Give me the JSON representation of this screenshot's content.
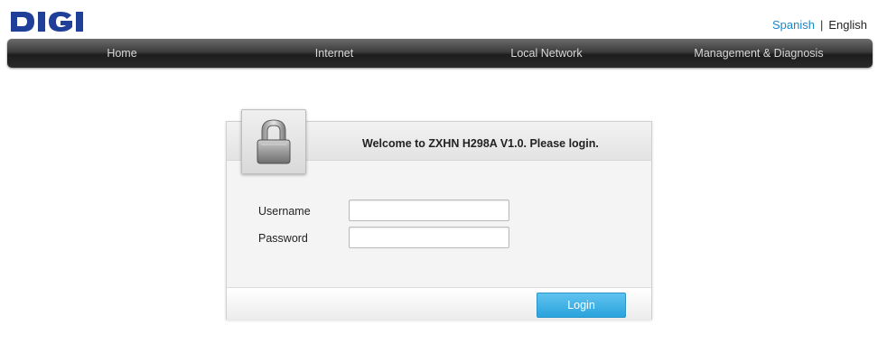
{
  "brand": {
    "logo_text": "DIGI",
    "logo_color": "#1f3f99"
  },
  "language": {
    "spanish": "Spanish",
    "separator": "|",
    "english": "English",
    "link_color": "#1a87c9"
  },
  "nav": {
    "items": [
      {
        "label": "Home"
      },
      {
        "label": "Internet"
      },
      {
        "label": "Local Network"
      },
      {
        "label": "Management & Diagnosis"
      }
    ]
  },
  "login": {
    "title": "Welcome to ZXHN H298A V1.0. Please login.",
    "lock_icon": "padlock-icon",
    "username_label": "Username",
    "username_value": "",
    "password_label": "Password",
    "password_value": "",
    "button_label": "Login",
    "button_color": "#2aa3dc"
  }
}
